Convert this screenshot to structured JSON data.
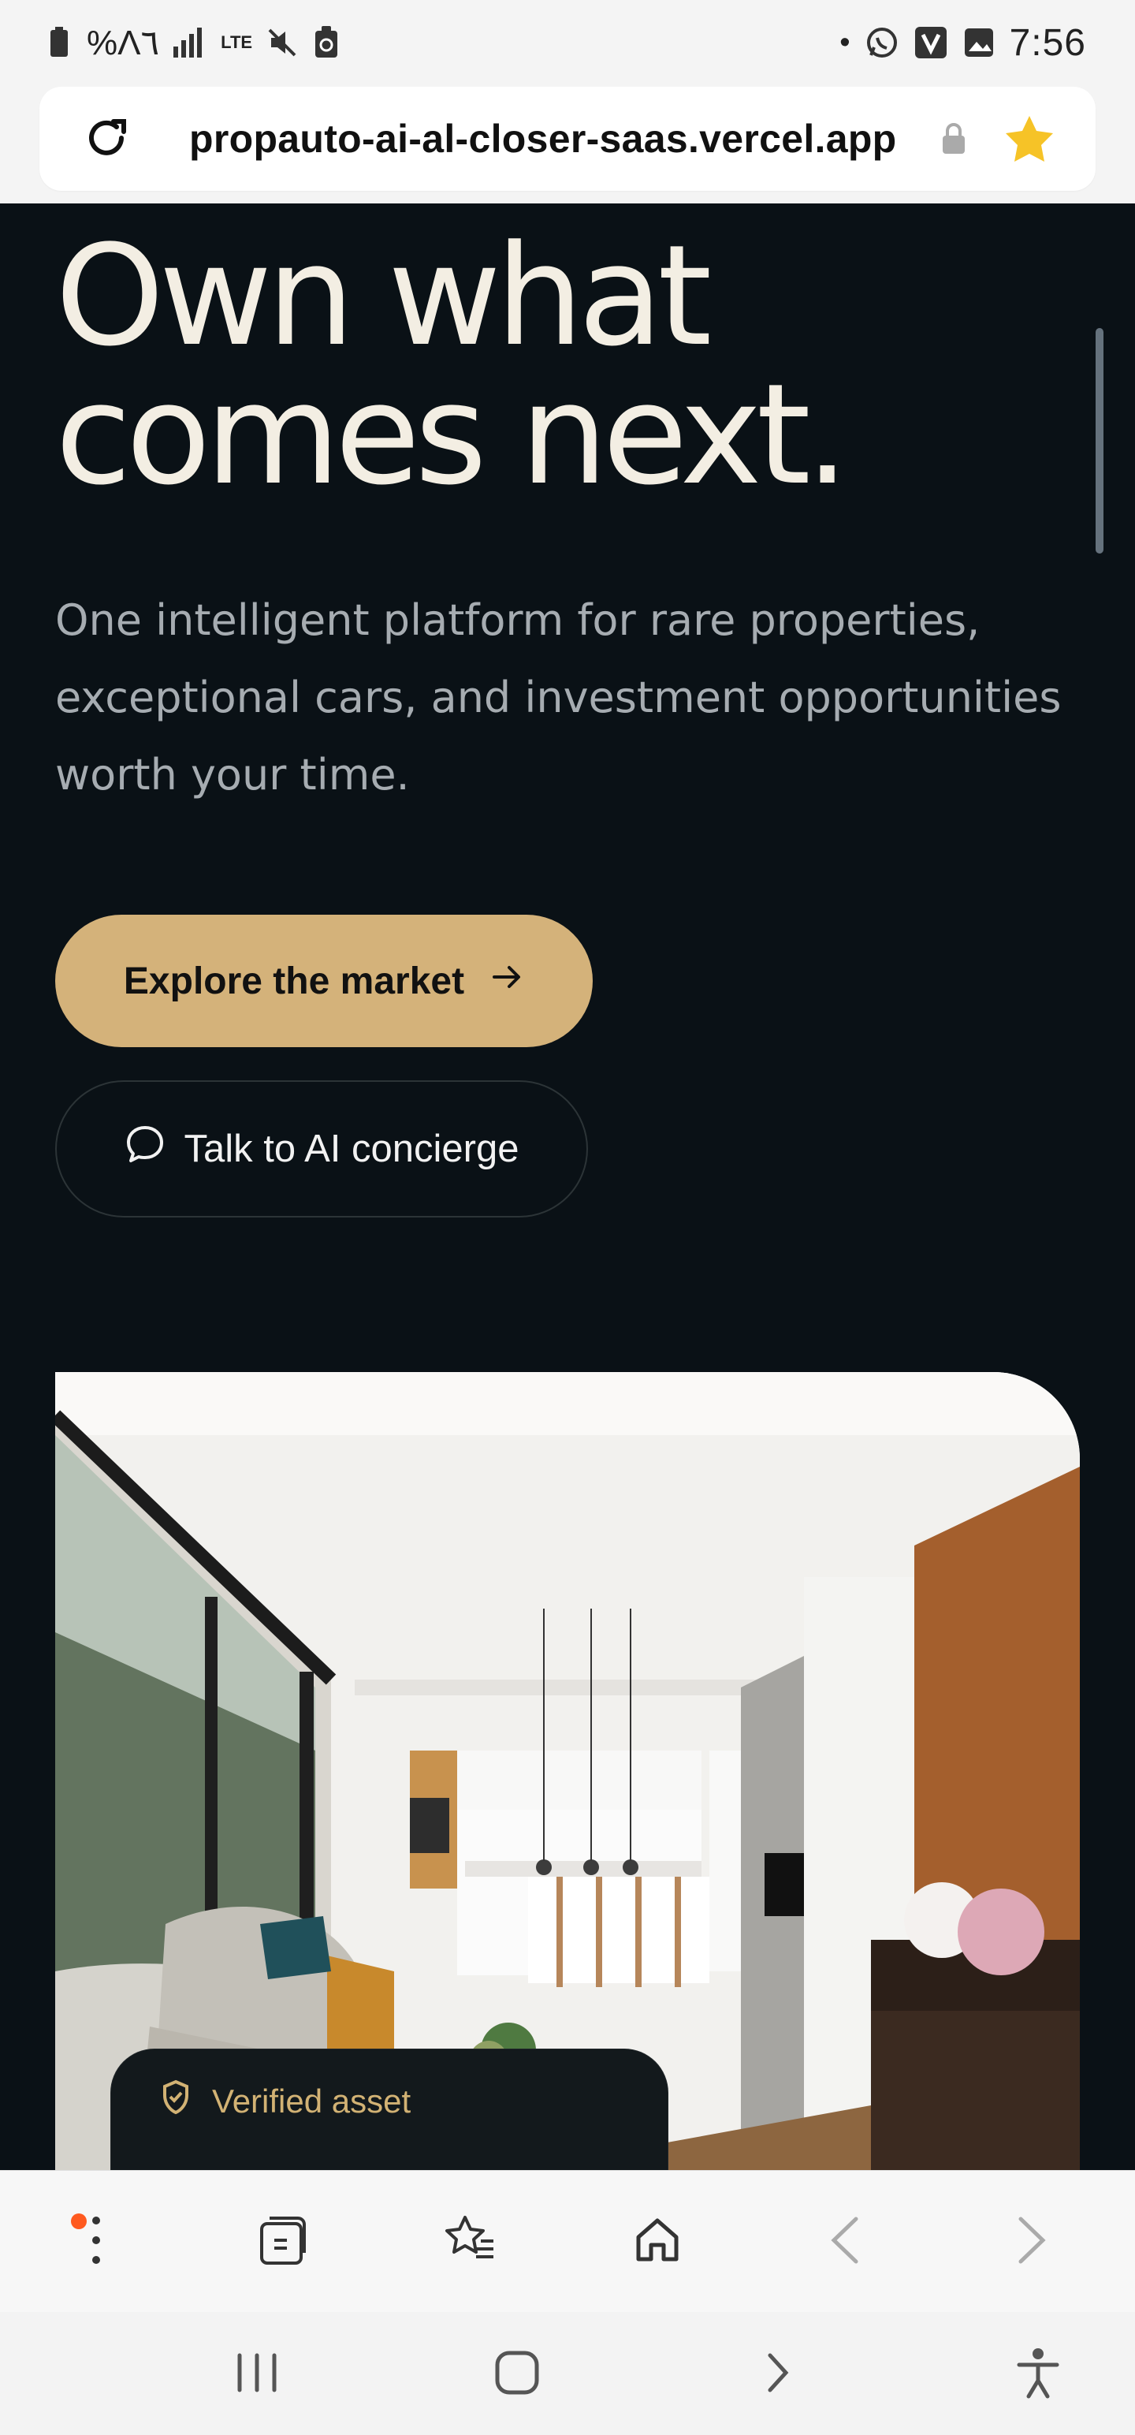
{
  "status_bar": {
    "battery_text": "%Λ٦",
    "signal_text": "LTE",
    "time": "7:56",
    "dot": "•"
  },
  "browser": {
    "url": "propauto-ai-al-closer-saas.vercel.app"
  },
  "hero": {
    "title_line_1": "Own what",
    "title_line_2": "comes next.",
    "subtitle": "One intelligent platform for rare properties, exceptional cars, and investment opportunities worth your time.",
    "cta_primary": "Explore the market",
    "cta_secondary": "Talk to AI concierge",
    "badge": "Verified asset"
  },
  "colors": {
    "background": "#0a1116",
    "accent_gold": "#d4b27a",
    "title_cream": "#f3eee3",
    "subtitle_gray": "#a6acb1",
    "badge_gold": "#d2b274",
    "browser_star": "#f6c327"
  },
  "icons": {
    "status_bar": [
      "battery-icon",
      "signal-icon",
      "lte-icon",
      "mute-icon",
      "recycle-icon",
      "notification-dot-icon",
      "whatsapp-icon",
      "vivaldi-icon",
      "image-icon"
    ],
    "browser": [
      "reload-icon",
      "lock-icon",
      "star-icon"
    ],
    "buttons": [
      "arrow-right-icon",
      "chat-bubble-icon",
      "shield-check-icon"
    ],
    "bottom_nav": [
      "more-menu-icon",
      "tabs-icon",
      "bookmarks-icon",
      "home-icon",
      "back-arrow-icon",
      "forward-arrow-icon"
    ],
    "system_nav": [
      "recent-apps-icon",
      "home-system-icon",
      "back-system-icon",
      "accessibility-icon"
    ]
  }
}
